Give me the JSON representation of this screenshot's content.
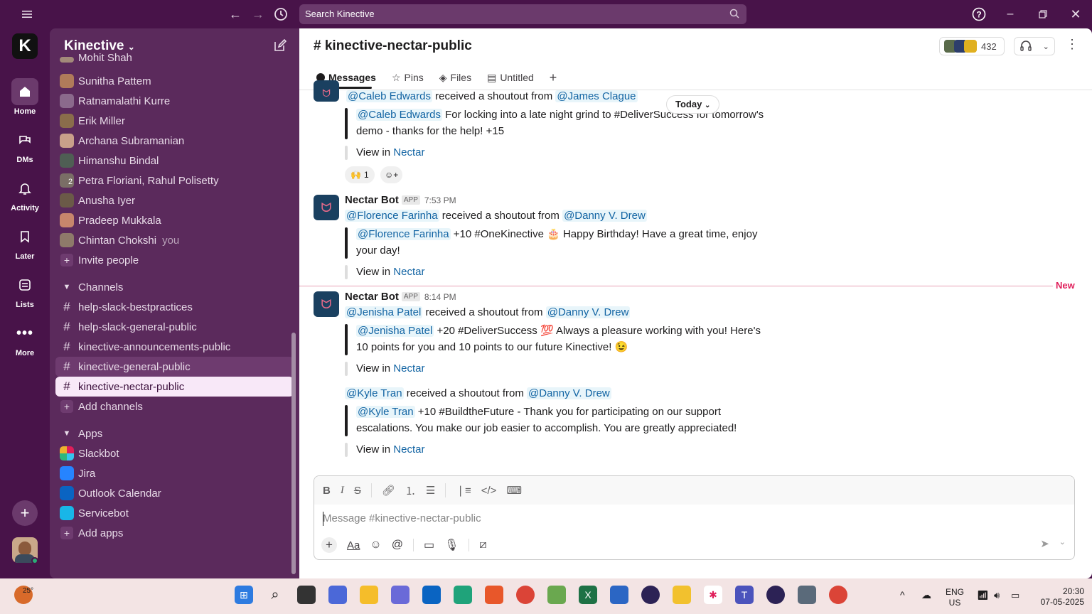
{
  "search": {
    "placeholder": "Search Kinective"
  },
  "rail": {
    "items": [
      {
        "label": "Home"
      },
      {
        "label": "DMs"
      },
      {
        "label": "Activity"
      },
      {
        "label": "Later"
      },
      {
        "label": "Lists"
      },
      {
        "label": "More"
      }
    ]
  },
  "sidebar": {
    "workspace": "Kinective",
    "partial_top": "Mohit Shah",
    "dms": [
      {
        "name": "Sunitha Pattem",
        "color": "#b07b5a"
      },
      {
        "name": "Ratnamalathi Kurre",
        "color": "#8b6a8c"
      },
      {
        "name": "Erik Miller",
        "color": "#8a6d4b"
      },
      {
        "name": "Archana Subramanian",
        "color": "#c9a08a"
      },
      {
        "name": "Himanshu Bindal",
        "color": "#4f5e54"
      },
      {
        "name": "Petra Floriani, Rahul Polisetty",
        "color": "#7a6e66",
        "count": "2"
      },
      {
        "name": "Anusha Iyer",
        "color": "#6b5a48"
      },
      {
        "name": "Pradeep Mukkala",
        "color": "#c7866c"
      },
      {
        "name": "Chintan Chokshi",
        "color": "#8e7a6a",
        "suffix": "you"
      }
    ],
    "invite": "Invite people",
    "channels_header": "Channels",
    "channels": [
      "help-slack-bestpractices",
      "help-slack-general-public",
      "kinective-announcements-public",
      "kinective-general-public",
      "kinective-nectar-public"
    ],
    "add_channels": "Add channels",
    "apps_header": "Apps",
    "apps": [
      {
        "name": "Slackbot",
        "color": "#e01e5a"
      },
      {
        "name": "Jira",
        "color": "#2684ff"
      },
      {
        "name": "Outlook Calendar",
        "color": "#0a64c2"
      },
      {
        "name": "Servicebot",
        "color": "#18b6e8"
      }
    ],
    "add_apps": "Add apps"
  },
  "channel": {
    "title": "# kinective-nectar-public",
    "member_count": "432",
    "tabs": [
      "Messages",
      "Pins",
      "Files",
      "Untitled"
    ]
  },
  "messages": {
    "today_label": "Today",
    "new_label": "New",
    "m0": {
      "recipient": "@Caleb Edwards",
      "mid": "received a shoutout from",
      "sender": "@James Clague",
      "quote_mention": "@Caleb Edwards",
      "quote_text_1": "For locking into a late night grind to #DeliverSuccess for tomorrow's",
      "quote_text_2": "demo - thanks for the help! +15",
      "view_prefix": "View in",
      "view_link": "Nectar",
      "reaction_emoji": "🙌",
      "reaction_count": "1"
    },
    "m1": {
      "author": "Nectar Bot",
      "badge": "APP",
      "time": "7:53 PM",
      "recipient": "@Florence Farinha",
      "mid": "received a shoutout from",
      "sender": "@Danny V. Drew",
      "quote_mention": "@Florence Farinha",
      "quote_text_1": "+10 #OneKinective 🎂 Happy Birthday! Have a great time, enjoy",
      "quote_text_2": "your day!",
      "view_prefix": "View in",
      "view_link": "Nectar"
    },
    "m2": {
      "author": "Nectar Bot",
      "badge": "APP",
      "time": "8:14 PM",
      "recipient": "@Jenisha Patel",
      "mid": "received a shoutout from",
      "sender": "@Danny V. Drew",
      "quote_mention": "@Jenisha Patel",
      "quote_text_1": "+20 #DeliverSuccess 💯 Always a pleasure working with you! Here's",
      "quote_text_2": "10 points for you and 10 points to our future Kinective! 😉",
      "view_prefix": "View in",
      "view_link": "Nectar"
    },
    "m3": {
      "recipient": "@Kyle Tran",
      "mid": "received a shoutout from",
      "sender": "@Danny V. Drew",
      "quote_mention": "@Kyle Tran",
      "quote_text_1": "+10 #BuildtheFuture - Thank you for participating on our support",
      "quote_text_2": "escalations. You make our job easier to accomplish. You are greatly appreciated!",
      "view_prefix": "View in",
      "view_link": "Nectar"
    }
  },
  "composer": {
    "placeholder": "Message #kinective-nectar-public"
  },
  "taskbar": {
    "weather": "25°",
    "lang1": "ENG",
    "lang2": "US",
    "time": "20:30",
    "date": "07-05-2025"
  }
}
